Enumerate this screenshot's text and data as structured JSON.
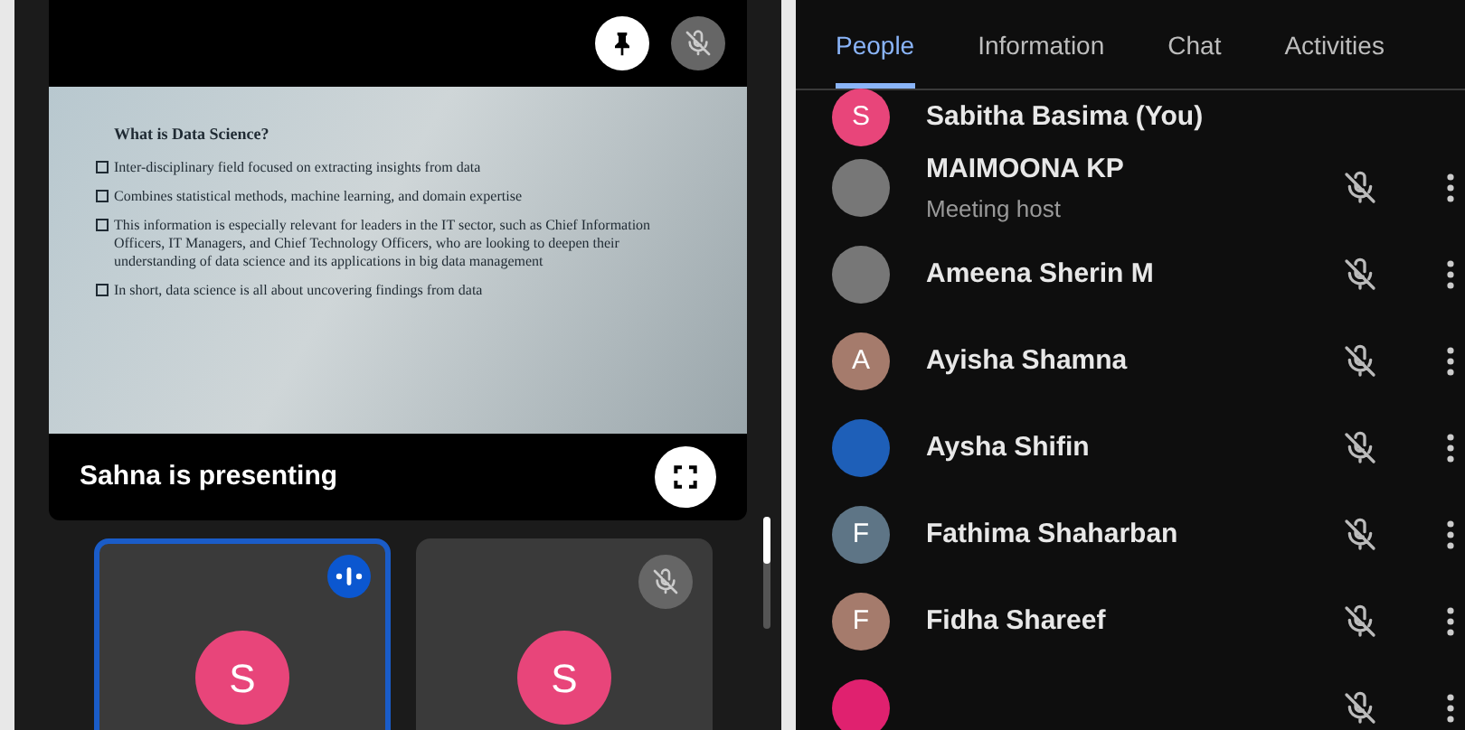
{
  "stage": {
    "pinned": true,
    "presenter_muted": true,
    "slide": {
      "title": "What is Data Science?",
      "bullets": [
        "Inter-disciplinary field focused on extracting insights from data",
        "Combines statistical methods, machine learning, and domain expertise",
        "This information is especially relevant for leaders in the IT sector, such as Chief Information Officers, IT Managers, and Chief Technology Officers, who are looking to deepen their understanding of data science and its applications in big data management",
        "In short, data science is all about uncovering findings from data"
      ]
    },
    "caption": "Sahna is presenting"
  },
  "tiles": [
    {
      "initial": "S",
      "speaking": true,
      "muted": false
    },
    {
      "initial": "S",
      "speaking": false,
      "muted": true
    }
  ],
  "tabs": [
    {
      "label": "People",
      "selected": true
    },
    {
      "label": "Information",
      "selected": false
    },
    {
      "label": "Chat",
      "selected": false
    },
    {
      "label": "Activities",
      "selected": false
    }
  ],
  "people": [
    {
      "kind": "letter",
      "initial": "S",
      "color": "#e8457a",
      "name": "Sabitha Basima (You)",
      "muted": false
    },
    {
      "kind": "photo",
      "name": "MAIMOONA KP",
      "subtitle": "Meeting host",
      "muted": true
    },
    {
      "kind": "photo",
      "name": "Ameena Sherin M",
      "muted": true
    },
    {
      "kind": "letter",
      "initial": "A",
      "color": "#a57b6c",
      "name": "Ayisha Shamna",
      "muted": true
    },
    {
      "kind": "image",
      "color": "#1e5fb8",
      "name": "Aysha Shifin",
      "muted": true
    },
    {
      "kind": "letter",
      "initial": "F",
      "color": "#5e7586",
      "name": "Fathima Shaharban",
      "muted": true
    },
    {
      "kind": "letter",
      "initial": "F",
      "color": "#a57b6c",
      "name": "Fidha Shareef",
      "muted": true
    },
    {
      "kind": "image",
      "color": "#e0216f",
      "muted": true
    }
  ]
}
